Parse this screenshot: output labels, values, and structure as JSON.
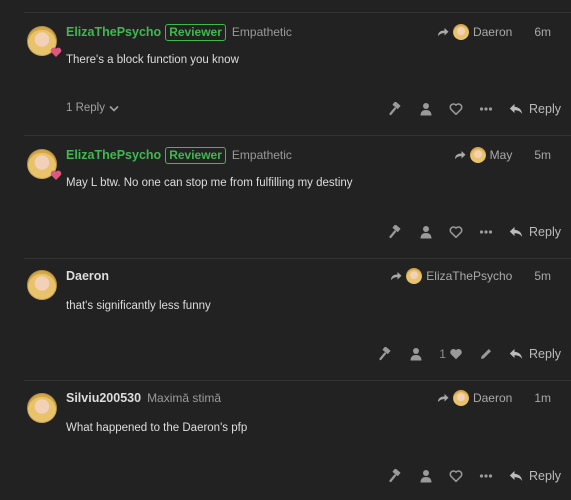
{
  "posts": [
    {
      "username": "ElizaThePsycho",
      "badge": "Reviewer",
      "user_title": "Empathetic",
      "reply_to": "Daeron",
      "time": "6m",
      "body": "There's a block function you know",
      "replies_label": "1 Reply",
      "reply_label": "Reply"
    },
    {
      "username": "ElizaThePsycho",
      "badge": "Reviewer",
      "user_title": "Empathetic",
      "reply_to": "May",
      "time": "5m",
      "body": "May L btw. No one can stop me from fulfilling my destiny",
      "reply_label": "Reply"
    },
    {
      "username": "Daeron",
      "reply_to": "ElizaThePsycho",
      "time": "5m",
      "body": "that's significantly less funny",
      "like_count": "1",
      "reply_label": "Reply"
    },
    {
      "username": "Silviu200530",
      "user_title": "Maximă stimă",
      "reply_to": "Daeron",
      "time": "1m",
      "body": "What happened to the Daeron's pfp",
      "reply_label": "Reply"
    }
  ],
  "colors": {
    "background": "#222222",
    "accent_green": "#3fb94f",
    "heart_pink": "#e0567f"
  }
}
